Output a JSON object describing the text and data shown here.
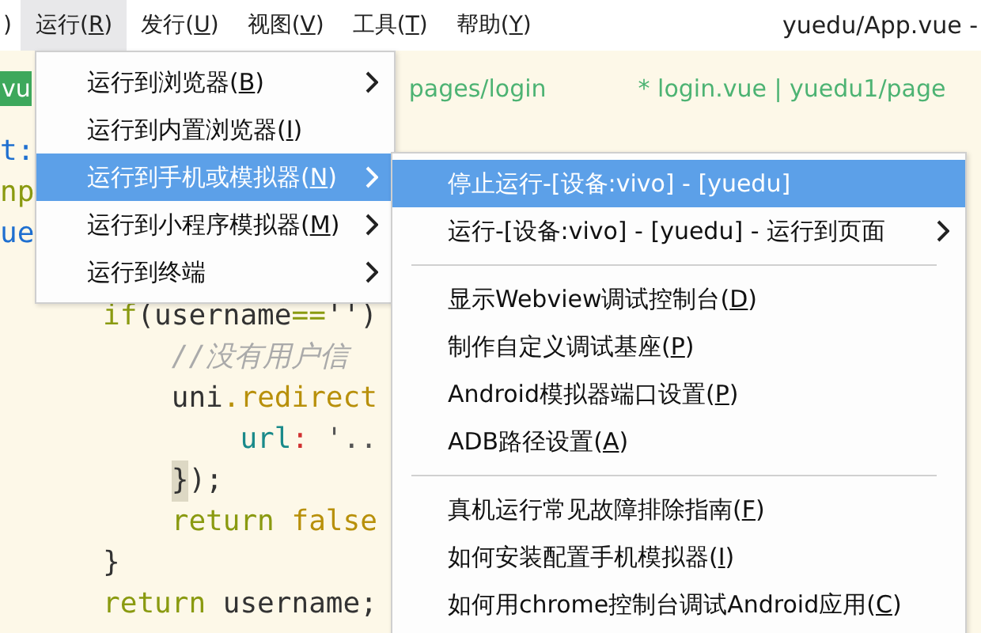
{
  "menubar": [
    {
      "before": ")",
      "selected": false
    },
    {
      "before": "运行(",
      "mnemonic": "R",
      "after": ")",
      "selected": true
    },
    {
      "before": "发行(",
      "mnemonic": "U",
      "after": ")",
      "selected": false
    },
    {
      "before": "视图(",
      "mnemonic": "V",
      "after": ")",
      "selected": false
    },
    {
      "before": "工具(",
      "mnemonic": "T",
      "after": ")",
      "selected": false
    },
    {
      "before": "帮助(",
      "mnemonic": "Y",
      "after": ")",
      "selected": false
    }
  ],
  "window": {
    "title": "yuedu/App.vue -"
  },
  "tabs": [
    {
      "label": "vu",
      "selected": true
    },
    {
      "label": "pages/login",
      "selected": false
    },
    {
      "label": "* login.vue | yuedu1/page",
      "selected": false
    }
  ],
  "code_blocks": [
    [
      [
        {
          "kind": "prop",
          "text": "t:"
        }
      ],
      [
        {
          "kind": "keyword",
          "text": "np"
        }
      ],
      [
        {
          "kind": "prop",
          "text": "ue"
        }
      ]
    ],
    [
      [
        {
          "kind": "keyword",
          "text": "      if"
        },
        {
          "kind": "plain",
          "text": "(username"
        },
        {
          "kind": "keyword",
          "text": "=="
        },
        {
          "kind": "plain",
          "text": "'')"
        }
      ],
      [
        {
          "kind": "comment",
          "text": "          //没有用户信"
        }
      ],
      [
        {
          "kind": "plain",
          "text": "          uni"
        },
        {
          "kind": "method",
          "text": ".redirect"
        }
      ],
      [
        {
          "kind": "attr",
          "text": "              url"
        },
        {
          "kind": "punct",
          "text": ":"
        },
        {
          "kind": "string",
          "text": " '.."
        }
      ],
      [
        {
          "kind": "bracket",
          "text": "          }"
        },
        {
          "kind": "plain",
          "text": ");"
        }
      ],
      [
        {
          "kind": "keyword",
          "text": "          return"
        },
        {
          "kind": "method",
          "text": " false"
        }
      ],
      [
        {
          "kind": "plain",
          "text": "      }"
        }
      ],
      [
        {
          "kind": "keyword",
          "text": "      return"
        },
        {
          "kind": "plain",
          "text": " username;"
        }
      ]
    ]
  ],
  "run_menu": [
    {
      "before": "运行到浏览器(",
      "mnemonic": "B",
      "after": ")",
      "submenu": true,
      "selected": false
    },
    {
      "before": "运行到内置浏览器(",
      "mnemonic": "I",
      "after": ")",
      "submenu": false,
      "selected": false
    },
    {
      "before": "运行到手机或模拟器(",
      "mnemonic": "N",
      "after": ")",
      "submenu": true,
      "selected": true
    },
    {
      "before": "运行到小程序模拟器(",
      "mnemonic": "M",
      "after": ")",
      "submenu": true,
      "selected": false
    },
    {
      "before": "运行到终端",
      "submenu": true,
      "selected": false
    }
  ],
  "device_menu": [
    {
      "kind": "item",
      "before": "停止运行-[设备:vivo] - [yuedu]",
      "submenu": false,
      "selected": true
    },
    {
      "kind": "item",
      "before": "运行-[设备:vivo] - [yuedu] - 运行到页面",
      "submenu": true,
      "selected": false
    },
    {
      "kind": "separator"
    },
    {
      "kind": "item",
      "before": "显示Webview调试控制台(",
      "mnemonic": "D",
      "after": ")",
      "submenu": false,
      "selected": false
    },
    {
      "kind": "item",
      "before": "制作自定义调试基座(",
      "mnemonic": "P",
      "after": ")",
      "submenu": false,
      "selected": false
    },
    {
      "kind": "item",
      "before": "Android模拟器端口设置(",
      "mnemonic": "P",
      "after": ")",
      "submenu": false,
      "selected": false
    },
    {
      "kind": "item",
      "before": "ADB路径设置(",
      "mnemonic": "A",
      "after": ")",
      "submenu": false,
      "selected": false
    },
    {
      "kind": "separator"
    },
    {
      "kind": "item",
      "before": "真机运行常见故障排除指南(",
      "mnemonic": "F",
      "after": ")",
      "submenu": false,
      "selected": false
    },
    {
      "kind": "item",
      "before": "如何安装配置手机模拟器(",
      "mnemonic": "I",
      "after": ")",
      "submenu": false,
      "selected": false
    },
    {
      "kind": "item",
      "before": "如何用chrome控制台调试Android应用(",
      "mnemonic": "C",
      "after": ")",
      "submenu": false,
      "selected": false
    }
  ]
}
